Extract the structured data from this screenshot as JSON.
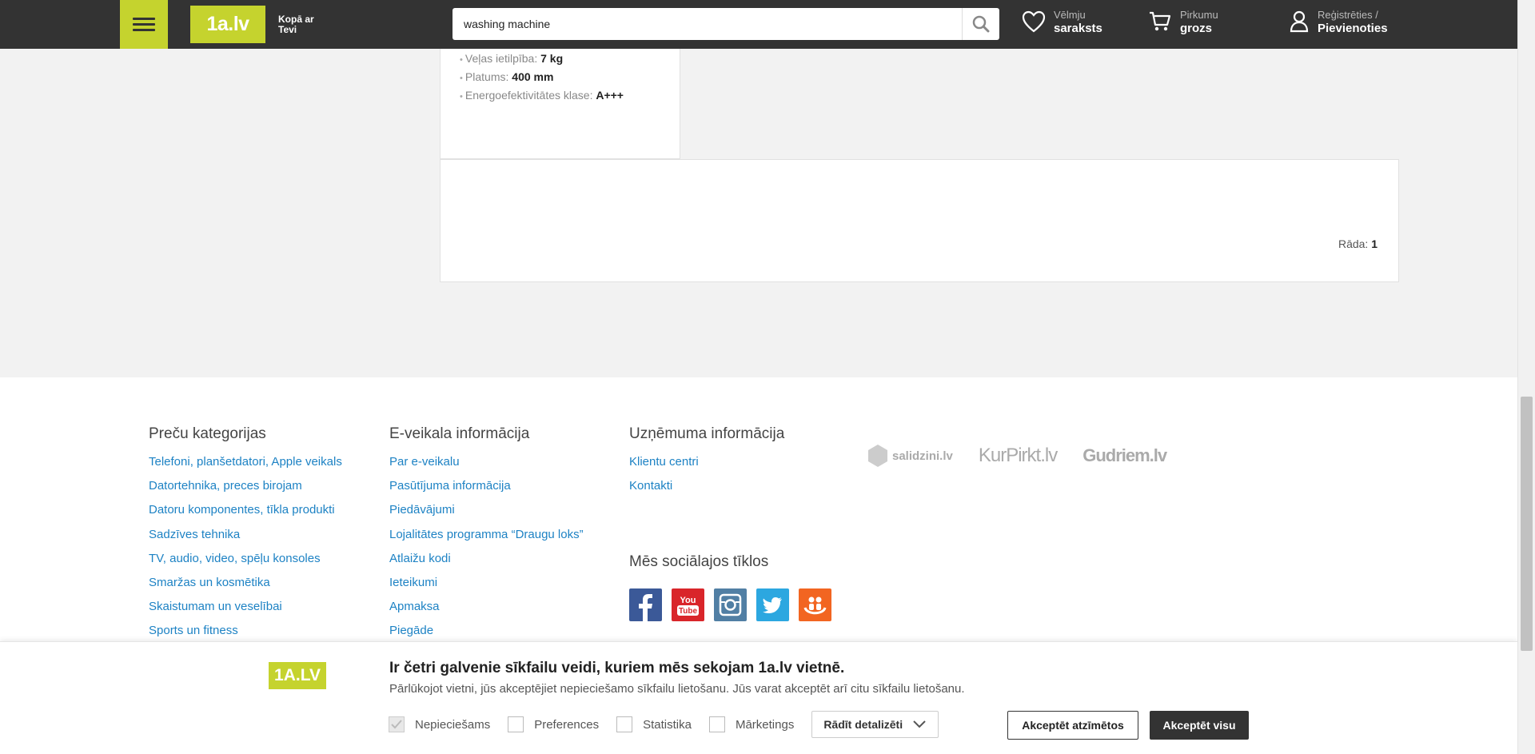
{
  "header": {
    "logo": "1a.lv",
    "tagline_line1": "Kopā ar",
    "tagline_line2": "Tevi",
    "search_value": "washing machine",
    "wishlist_small": "Vēlmju",
    "wishlist_big": "saraksts",
    "cart_small": "Pirkumu",
    "cart_big": "grozs",
    "account_small": "Reģistrēties /",
    "account_big": "Pievienoties"
  },
  "product": {
    "specs": [
      {
        "label": "Veļas ietilpība:",
        "value": "7 kg"
      },
      {
        "label": "Platums:",
        "value": "400 mm"
      },
      {
        "label": "Energoefektivitātes klase:",
        "value": "A+++"
      }
    ]
  },
  "pager": {
    "shows_label": "Rāda:",
    "shows_value": "1"
  },
  "footer": {
    "categories": {
      "title": "Preču kategorijas",
      "items": [
        "Telefoni, planšetdatori, Apple veikals",
        "Datortehnika, preces birojam",
        "Datoru komponentes, tīkla produkti",
        "Sadzīves tehnika",
        "TV, audio, video, spēļu konsoles",
        "Smaržas un kosmētika",
        "Skaistumam un veselībai",
        "Sports un fitness"
      ]
    },
    "shop_info": {
      "title": "E-veikala informācija",
      "items": [
        "Par e-veikalu",
        "Pasūtījuma informācija",
        "Piedāvājumi",
        "Lojalitātes programma “Draugu loks”",
        "Atlaižu kodi",
        "Ieteikumi",
        "Apmaksa",
        "Piegāde"
      ]
    },
    "company_info": {
      "title": "Uzņēmuma informācija",
      "items": [
        "Klientu centri",
        "Kontakti"
      ]
    },
    "social_title": "Mēs sociālajos tīklos",
    "partners": [
      "salidzini.lv",
      "KurPirkt.lv",
      "Gudriem.lv"
    ]
  },
  "cookie": {
    "logo": "1A.LV",
    "title": "Ir četri galvenie sīkfailu veidi, kuriem mēs sekojam 1a.lv vietnē.",
    "text": "Pārlūkojot vietni, jūs akceptējiet nepieciešamo sīkfailu lietošanu. Jūs varat akceptēt arī citu sīkfailu lietošanu.",
    "necessary": "Nepieciešams",
    "preferences": "Preferences",
    "statistics": "Statistika",
    "marketing": "Mārketings",
    "details": "Rādīt detalizēti",
    "accept_selected": "Akceptēt atzīmētos",
    "accept_all": "Akceptēt visu"
  }
}
